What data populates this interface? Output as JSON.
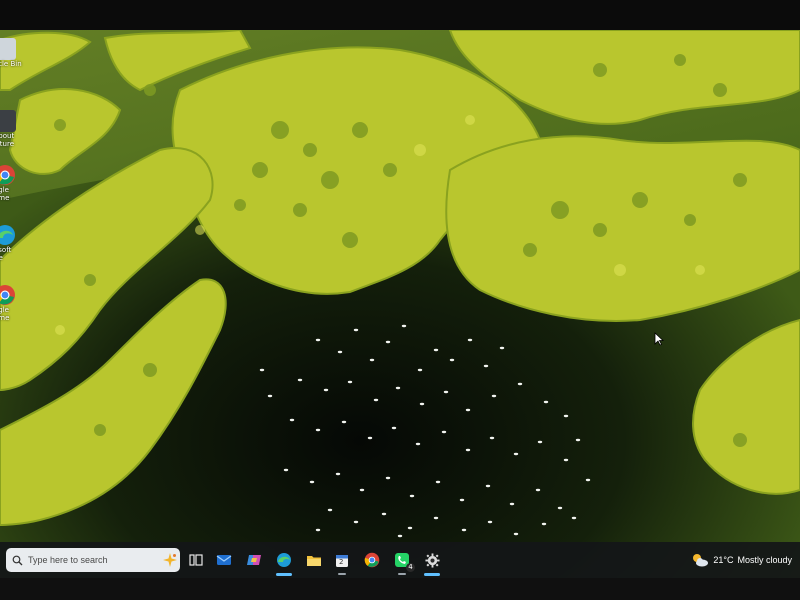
{
  "desktop": {
    "icons": [
      {
        "name": "recycle-bin",
        "label": "ycle Bin"
      },
      {
        "name": "about-picture",
        "label": "about\nicture"
      },
      {
        "name": "google-chrome",
        "label": "ogle\nome"
      },
      {
        "name": "microsoft-edge",
        "label": "osoft\nge"
      },
      {
        "name": "google-chrome-2",
        "label": "ogle\nome"
      }
    ]
  },
  "taskbar": {
    "search_placeholder": "Type here to search",
    "apps": [
      "task-view-icon",
      "mail-icon",
      "copilot-icon",
      "edge-icon",
      "file-explorer-icon",
      "calendar-icon",
      "chrome-icon",
      "whatsapp-icon",
      "settings-icon"
    ],
    "whatsapp_badge": "4",
    "calendar_day": "2"
  },
  "weather": {
    "temperature": "21°C",
    "condition": "Mostly cloudy"
  },
  "colors": {
    "taskbar_bg": "#141618",
    "accent": "#60c0ff",
    "marsh_yellow": "#c9d33a",
    "water_green": "#4b6a1c"
  }
}
